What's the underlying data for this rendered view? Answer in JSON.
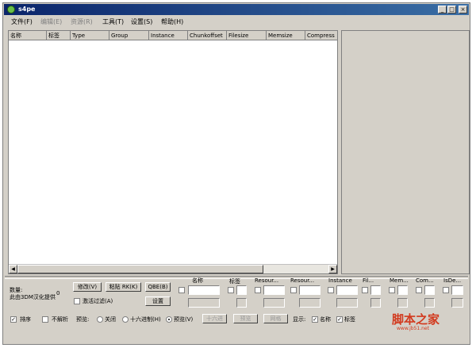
{
  "title": "s4pe",
  "window_buttons": {
    "minimize": "_",
    "maximize": "□",
    "close": "×"
  },
  "menu": [
    "文件(F)",
    "编辑(E)",
    "资源(R)",
    "工具(T)",
    "设置(S)",
    "帮助(H)"
  ],
  "columns": [
    "名称",
    "标签",
    "Type",
    "Group",
    "Instance",
    "Chunkoffset",
    "Filesize",
    "Memsize",
    "Compress"
  ],
  "bottom": {
    "count_label": "数量:",
    "count_value": "0",
    "credit": "此由3DM汉化提供",
    "modify": "修改(V)",
    "paste_rk": "粘贴 RK(K)",
    "qbe": "QBE(B)",
    "activate_filter": "激活过滤(A)",
    "settings": "设置",
    "sort": "排序",
    "no_parse": "不解析",
    "preview_label": "预览:",
    "preview_options": [
      "关闭",
      "十六进制(H)",
      "预览(V)"
    ],
    "preview_selected": 2,
    "hex_btn": "十六进",
    "preview_btn": "预览",
    "replace_btn": "网格",
    "display_label": "显示:",
    "display_name": "名称",
    "display_tag": "标签",
    "filter_headers": [
      "名称",
      "标签",
      "Resour...",
      "Resour...",
      "Instance",
      "Fil...",
      "Mem...",
      "Com...",
      "IsDe..."
    ]
  },
  "watermark": "脚本之家",
  "watermark_url": "www.jb51.net"
}
